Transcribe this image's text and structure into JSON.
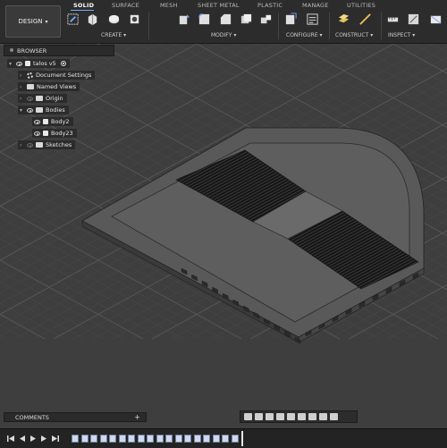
{
  "toolbar": {
    "workspace_label": "DESIGN",
    "tabs": [
      "SOLID",
      "SURFACE",
      "MESH",
      "SHEET METAL",
      "PLASTIC",
      "MANAGE",
      "UTILITIES"
    ],
    "active_tab": "SOLID",
    "groups": [
      "CREATE ▾",
      "MODIFY ▾",
      "CONFIGURE ▾",
      "CONSTRUCT ▾",
      "INSPECT ▾"
    ]
  },
  "browser": {
    "title": "BROWSER",
    "root": "talos v5",
    "items": [
      {
        "label": "Document Settings"
      },
      {
        "label": "Named Views"
      },
      {
        "label": "Origin"
      },
      {
        "label": "Bodies"
      },
      {
        "label": "Body2"
      },
      {
        "label": "Body23"
      },
      {
        "label": "Sketches"
      }
    ]
  },
  "comments": {
    "title": "COMMENTS",
    "add": "+"
  },
  "colors": {
    "accent": "#6fa8ff",
    "toolbar_bg": "#2c2c2c",
    "viewport_bg": "#3e3e3e",
    "body_top": "#5a5a5a",
    "slats": "#111111"
  }
}
